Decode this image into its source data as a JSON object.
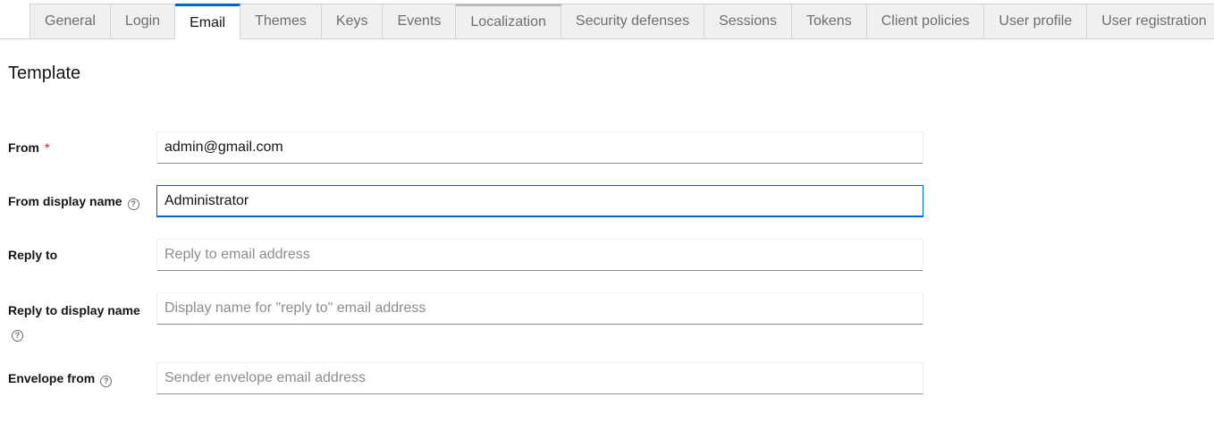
{
  "tabs": [
    "General",
    "Login",
    "Email",
    "Themes",
    "Keys",
    "Events",
    "Localization",
    "Security defenses",
    "Sessions",
    "Tokens",
    "Client policies",
    "User profile",
    "User registration"
  ],
  "active_tab": "Email",
  "section_title": "Template",
  "fields": {
    "from": {
      "label": "From",
      "required_mark": "*",
      "value": "admin@gmail.com"
    },
    "from_display_name": {
      "label": "From display name",
      "value": "Administrator",
      "help_icon": "?"
    },
    "reply_to": {
      "label": "Reply to",
      "placeholder": "Reply to email address"
    },
    "reply_to_display_name": {
      "label": "Reply to display name",
      "placeholder": "Display name for \"reply to\" email address",
      "help_icon": "?"
    },
    "envelope_from": {
      "label": "Envelope from",
      "placeholder": "Sender envelope email address",
      "help_icon": "?"
    }
  }
}
